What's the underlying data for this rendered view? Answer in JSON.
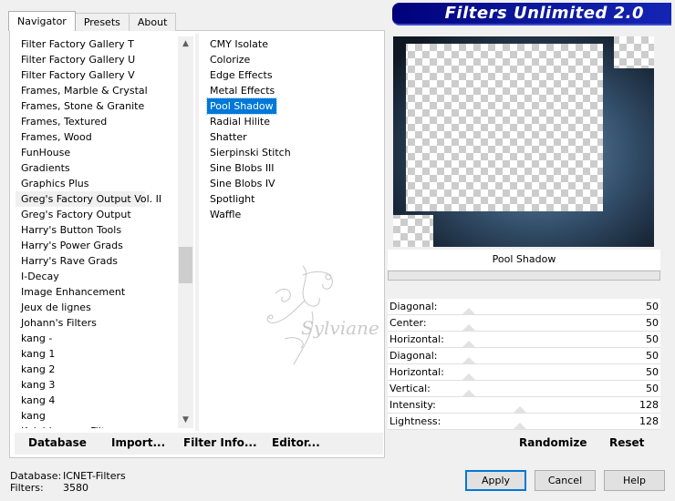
{
  "tabs": [
    "Navigator",
    "Presets",
    "About"
  ],
  "banner": {
    "title": "Filters Unlimited 2.0"
  },
  "categories": [
    "Filter Factory Gallery T",
    "Filter Factory Gallery U",
    "Filter Factory Gallery V",
    "Frames, Marble & Crystal",
    "Frames, Stone & Granite",
    "Frames, Textured",
    "Frames, Wood",
    "FunHouse",
    "Gradients",
    "Graphics Plus",
    "Greg's Factory Output Vol. II",
    "Greg's Factory Output",
    "Harry's Button Tools",
    "Harry's Power Grads",
    "Harry's Rave Grads",
    "I-Decay",
    "Image Enhancement",
    "Jeux de lignes",
    "Johann's Filters",
    "kang -",
    "kang 1",
    "kang 2",
    "kang 3",
    "kang 4",
    "kang",
    "Kaleidoscope Filters"
  ],
  "selected_category_index": 10,
  "filters": [
    "CMY Isolate",
    "Colorize",
    "Edge Effects",
    "Metal Effects",
    "Pool Shadow",
    "Radial Hilite",
    "Shatter",
    "Sierpinski Stitch",
    "Sine Blobs III",
    "Sine Blobs IV",
    "Spotlight",
    "Waffle"
  ],
  "selected_filter_index": 4,
  "watermark": {
    "text": "Sylviane"
  },
  "left_buttons": {
    "database": "Database",
    "import": "Import...",
    "filter_info": "Filter Info...",
    "editor": "Editor..."
  },
  "preview_caption": "Pool Shadow",
  "params": [
    {
      "label": "Diagonal:",
      "value": "50",
      "fraction": 0.2
    },
    {
      "label": "Center:",
      "value": "50",
      "fraction": 0.2
    },
    {
      "label": "Horizontal:",
      "value": "50",
      "fraction": 0.2
    },
    {
      "label": "Diagonal:",
      "value": "50",
      "fraction": 0.2
    },
    {
      "label": "Horizontal:",
      "value": "50",
      "fraction": 0.2
    },
    {
      "label": "Vertical:",
      "value": "50",
      "fraction": 0.2
    },
    {
      "label": "Intensity:",
      "value": "128",
      "fraction": 0.5
    },
    {
      "label": "Lightness:",
      "value": "128",
      "fraction": 0.5
    }
  ],
  "right_buttons": {
    "randomize": "Randomize",
    "reset": "Reset"
  },
  "status": {
    "database_label": "Database:",
    "database_value": "ICNET-Filters",
    "filters_label": "Filters:",
    "filters_value": "3580"
  },
  "dialog_buttons": {
    "apply": "Apply",
    "cancel": "Cancel",
    "help": "Help"
  },
  "colors": {
    "selection": "#0078d7",
    "banner": "#0a1496",
    "preview_glow": "#4a6a8a"
  }
}
